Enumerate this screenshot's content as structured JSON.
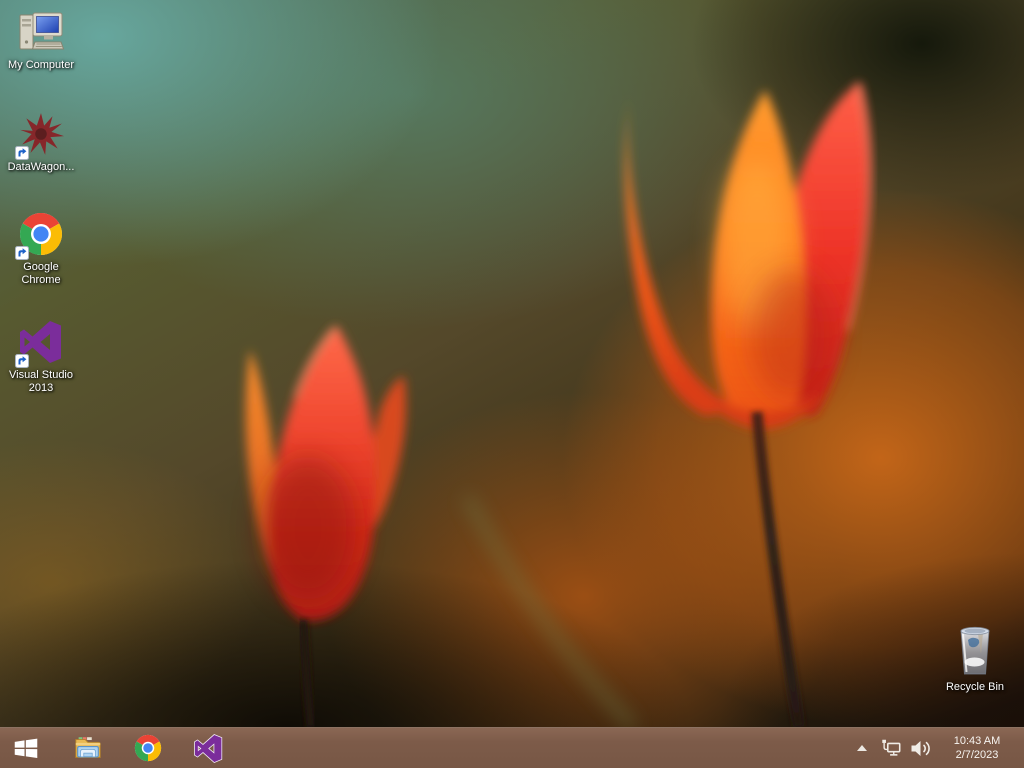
{
  "desktop": {
    "icons": [
      {
        "label": "My Computer"
      },
      {
        "label": "DataWagon..."
      },
      {
        "label": "Google Chrome"
      },
      {
        "label": "Visual Studio 2013"
      },
      {
        "label": "Recycle Bin"
      }
    ]
  },
  "taskbar": {
    "tray": {
      "time": "10:43 AM",
      "date": "2/7/2023"
    }
  },
  "theme": {
    "taskbar_color": "#7d5b49",
    "wallpaper_teal": "#5f9e98",
    "wallpaper_orange_glow": "#c06a1e",
    "tulip_orange": "#ff7c1e",
    "tulip_red": "#d8281a",
    "vs_purple": "#7b2d9b",
    "chrome_red": "#ea4335",
    "chrome_yellow": "#fbbc05",
    "chrome_green": "#34a853",
    "chrome_blue": "#4285f4"
  }
}
